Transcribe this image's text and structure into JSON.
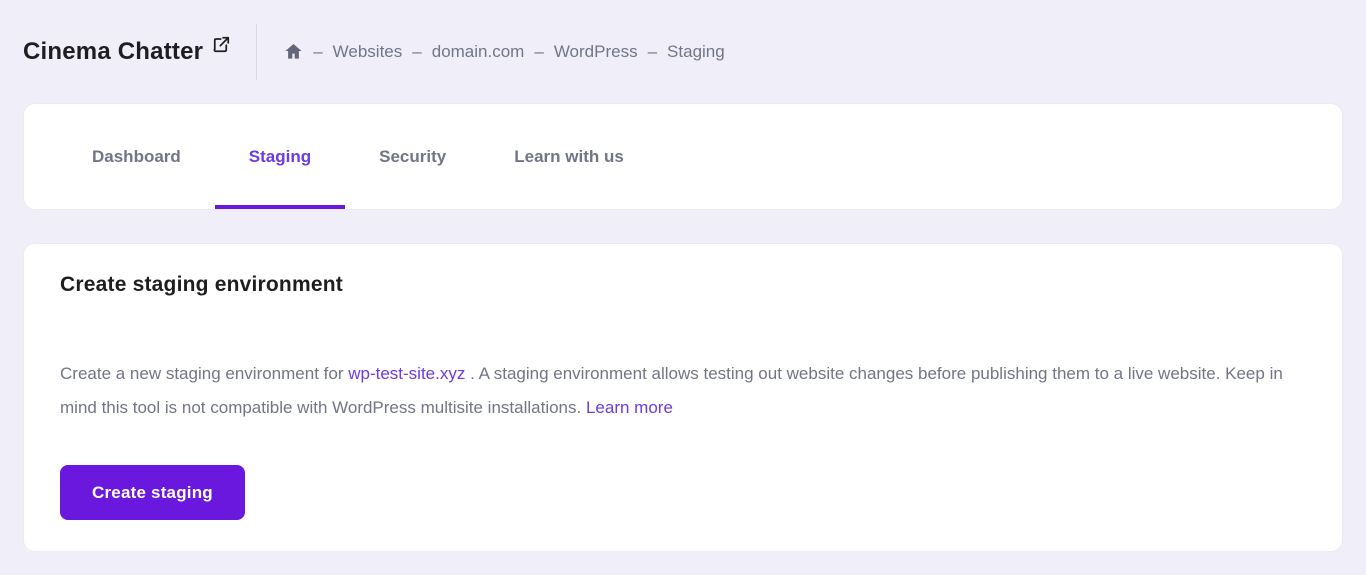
{
  "colors": {
    "accent": "#6a17de",
    "link": "#6d3ae3",
    "page_background": "#f0eff9",
    "card_background": "#ffffff",
    "muted_text": "#727586",
    "heading_text": "#1d1e20"
  },
  "header": {
    "site_title": "Cinema Chatter",
    "external_link_icon": "external-link-icon",
    "breadcrumb": {
      "home_icon": "home-icon",
      "separator": "–",
      "items": [
        "Websites",
        "domain.com",
        "WordPress",
        "Staging"
      ]
    }
  },
  "tabs": [
    {
      "label": "Dashboard",
      "active": false
    },
    {
      "label": "Staging",
      "active": true
    },
    {
      "label": "Security",
      "active": false
    },
    {
      "label": "Learn with us",
      "active": false
    }
  ],
  "staging_card": {
    "title": "Create staging environment",
    "description_part1": "Create a new staging environment for ",
    "domain_link": "wp-test-site.xyz",
    "description_part2": " . A staging environment allows testing out website changes before publishing them to a live website. Keep in mind this tool is not compatible with WordPress multisite installations. ",
    "learn_more_link": "Learn more",
    "create_button_label": "Create staging"
  }
}
